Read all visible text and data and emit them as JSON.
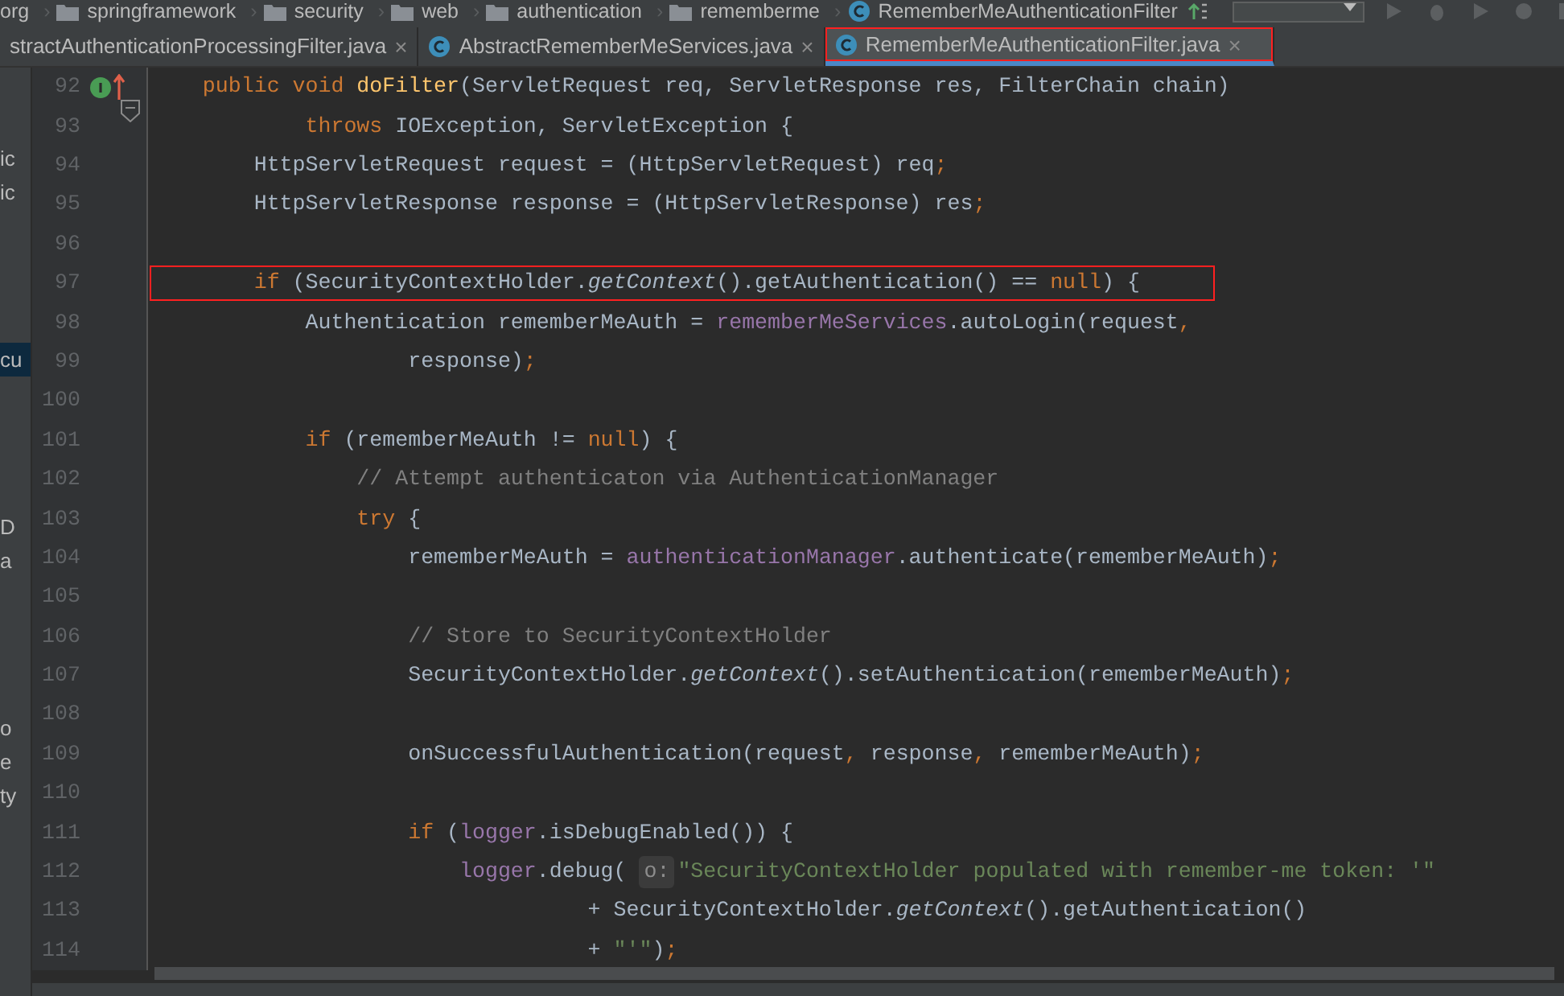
{
  "breadcrumb": [
    {
      "label": "org",
      "sep": "›"
    },
    {
      "label": "springframework",
      "kind": "folder",
      "sep": "›"
    },
    {
      "label": "security",
      "kind": "folder",
      "sep": "›"
    },
    {
      "label": "web",
      "kind": "folder",
      "sep": "›"
    },
    {
      "label": "authentication",
      "kind": "folder",
      "sep": "›"
    },
    {
      "label": "rememberme",
      "kind": "folder",
      "sep": "›"
    },
    {
      "label": "RememberMeAuthenticationFilter",
      "kind": "class"
    }
  ],
  "tabs": [
    {
      "label": "stractAuthenticationProcessingFilter.java",
      "close": "×",
      "selected": false,
      "annotated": false,
      "icon": false
    },
    {
      "label": "AbstractRememberMeServices.java",
      "close": "×",
      "selected": false,
      "annotated": false,
      "icon": true
    },
    {
      "label": "RememberMeAuthenticationFilter.java",
      "close": "×",
      "selected": true,
      "annotated": true,
      "icon": true
    }
  ],
  "project_tree": [
    [
      {
        "text": "ic",
        "selected": false
      },
      {
        "text": "ic",
        "selected": false
      }
    ],
    [
      {
        "text": "cu",
        "selected": true
      }
    ],
    [
      {
        "text": "D",
        "selected": false
      },
      {
        "text": "a",
        "selected": false
      }
    ],
    [
      {
        "text": "o",
        "selected": false
      },
      {
        "text": "e",
        "selected": false
      },
      {
        "text": "ty",
        "selected": false
      }
    ]
  ],
  "lines": [
    {
      "number": "92",
      "annotated": false,
      "tokens": [
        {
          "text": "    public void ",
          "kind": "keyword"
        },
        {
          "text": "doFilter",
          "kind": "decl"
        },
        {
          "text": "(ServletRequest req, ServletResponse res, FilterChain chain)",
          "kind": "plain"
        }
      ]
    },
    {
      "number": "93",
      "annotated": false,
      "tokens": [
        {
          "text": "            throws ",
          "kind": "keyword"
        },
        {
          "text": "IOException, ServletException {",
          "kind": "plain"
        }
      ]
    },
    {
      "number": "94",
      "annotated": false,
      "tokens": [
        {
          "text": "        HttpServletRequest request = (HttpServletRequest) req",
          "kind": "plain"
        },
        {
          "text": ";",
          "kind": "keyword"
        }
      ]
    },
    {
      "number": "95",
      "annotated": false,
      "tokens": [
        {
          "text": "        HttpServletResponse response = (HttpServletResponse) res",
          "kind": "plain"
        },
        {
          "text": ";",
          "kind": "keyword"
        }
      ]
    },
    {
      "number": "96"
    },
    {
      "number": "97",
      "annotated": true,
      "tokens": [
        {
          "text": "        if ",
          "kind": "keyword"
        },
        {
          "text": "(SecurityContextHolder.",
          "kind": "plain"
        },
        {
          "text": "getContext",
          "kind": "static"
        },
        {
          "text": "().getAuthentication() == ",
          "kind": "plain"
        },
        {
          "text": "null",
          "kind": "keyword"
        },
        {
          "text": ") {",
          "kind": "plain"
        }
      ]
    },
    {
      "number": "98",
      "annotated": false,
      "tokens": [
        {
          "text": "            Authentication rememberMeAuth = ",
          "kind": "plain"
        },
        {
          "text": "rememberMeServices",
          "kind": "field"
        },
        {
          "text": ".autoLogin(request",
          "kind": "plain"
        },
        {
          "text": ",",
          "kind": "keyword"
        }
      ]
    },
    {
      "number": "99",
      "annotated": false,
      "tokens": [
        {
          "text": "                    response)",
          "kind": "plain"
        },
        {
          "text": ";",
          "kind": "keyword"
        }
      ]
    },
    {
      "number": "100"
    },
    {
      "number": "101",
      "annotated": false,
      "tokens": [
        {
          "text": "            if ",
          "kind": "keyword"
        },
        {
          "text": "(rememberMeAuth != ",
          "kind": "plain"
        },
        {
          "text": "null",
          "kind": "keyword"
        },
        {
          "text": ") {",
          "kind": "plain"
        }
      ]
    },
    {
      "number": "102",
      "annotated": false,
      "tokens": [
        {
          "text": "                // Attempt authenticaton via AuthenticationManager",
          "kind": "comment"
        }
      ]
    },
    {
      "number": "103",
      "annotated": false,
      "tokens": [
        {
          "text": "                try ",
          "kind": "keyword"
        },
        {
          "text": "{",
          "kind": "plain"
        }
      ]
    },
    {
      "number": "104",
      "annotated": false,
      "tokens": [
        {
          "text": "                    rememberMeAuth = ",
          "kind": "plain"
        },
        {
          "text": "authenticationManager",
          "kind": "field"
        },
        {
          "text": ".authenticate(rememberMeAuth)",
          "kind": "plain"
        },
        {
          "text": ";",
          "kind": "keyword"
        }
      ]
    },
    {
      "number": "105"
    },
    {
      "number": "106",
      "annotated": false,
      "tokens": [
        {
          "text": "                    // Store to SecurityContextHolder",
          "kind": "comment"
        }
      ]
    },
    {
      "number": "107",
      "annotated": false,
      "tokens": [
        {
          "text": "                    SecurityContextHolder.",
          "kind": "plain"
        },
        {
          "text": "getContext",
          "kind": "static"
        },
        {
          "text": "().setAuthentication(rememberMeAuth)",
          "kind": "plain"
        },
        {
          "text": ";",
          "kind": "keyword"
        }
      ]
    },
    {
      "number": "108"
    },
    {
      "number": "109",
      "annotated": false,
      "tokens": [
        {
          "text": "                    onSuccessfulAuthentication(request",
          "kind": "plain"
        },
        {
          "text": ", ",
          "kind": "keyword"
        },
        {
          "text": "response",
          "kind": "plain"
        },
        {
          "text": ", ",
          "kind": "keyword"
        },
        {
          "text": "rememberMeAuth)",
          "kind": "plain"
        },
        {
          "text": ";",
          "kind": "keyword"
        }
      ]
    },
    {
      "number": "110"
    },
    {
      "number": "111",
      "annotated": false,
      "tokens": [
        {
          "text": "                    if ",
          "kind": "keyword"
        },
        {
          "text": "(",
          "kind": "plain"
        },
        {
          "text": "logger",
          "kind": "field"
        },
        {
          "text": ".isDebugEnabled()) {",
          "kind": "plain"
        }
      ]
    },
    {
      "number": "112",
      "annotated": false,
      "tokens": [
        {
          "text": "                        logger",
          "kind": "field"
        },
        {
          "text": ".debug( ",
          "kind": "plain"
        },
        {
          "text": "o:",
          "kind": "hint"
        },
        {
          "text": "\"SecurityContextHolder populated with remember-me token: '\"",
          "kind": "string"
        }
      ]
    },
    {
      "number": "113",
      "annotated": false,
      "tokens": [
        {
          "text": "                                  + SecurityContextHolder.",
          "kind": "plain"
        },
        {
          "text": "getContext",
          "kind": "static"
        },
        {
          "text": "().getAuthentication()",
          "kind": "plain"
        }
      ]
    },
    {
      "number": "114",
      "annotated": false,
      "tokens": [
        {
          "text": "                                  + ",
          "kind": "plain"
        },
        {
          "text": "\"'\"",
          "kind": "string"
        },
        {
          "text": ")",
          "kind": "plain"
        },
        {
          "text": ";",
          "kind": "keyword"
        }
      ]
    }
  ]
}
